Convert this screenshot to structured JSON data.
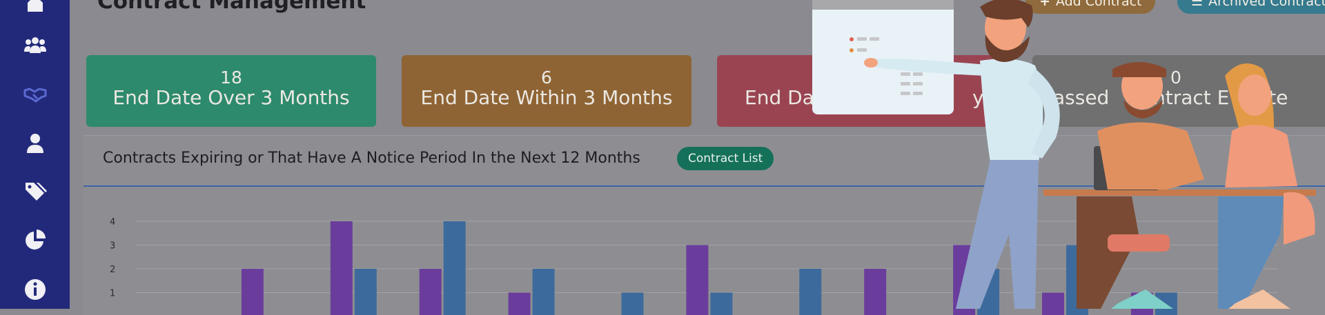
{
  "sidebar": {
    "items": [
      {
        "icon": "home-icon"
      },
      {
        "icon": "users-icon"
      },
      {
        "icon": "handshake-icon",
        "active": true
      },
      {
        "icon": "user-icon"
      },
      {
        "icon": "tags-icon"
      },
      {
        "icon": "pie-chart-icon"
      },
      {
        "icon": "info-icon"
      }
    ],
    "accent": "#5b6ad0"
  },
  "header": {
    "title": "Contract Management",
    "add_label": "Add Contract",
    "archived_label": "Archived Contracts",
    "add_icon": "plus-icon",
    "archived_icon": "list-icon"
  },
  "cards": [
    {
      "value": "18",
      "label": "End Date Over 3 Months",
      "color": "#2d8a6c"
    },
    {
      "value": "6",
      "label": "End Date Within 3 Months",
      "color": "#8f6434"
    },
    {
      "value": "",
      "label": "End Dat",
      "label_tail": "ys",
      "color": "#9a4452"
    },
    {
      "value": "0",
      "label": "assed",
      "label_tail": "ntract E",
      "label_end": "ate",
      "color": "#707070"
    }
  ],
  "panel": {
    "title": "Contracts Expiring or That Have A Notice Period In the Next 12 Months",
    "button_label": "Contract List"
  },
  "chart_data": {
    "type": "bar",
    "ylim": [
      0,
      4
    ],
    "yticks": [
      "1",
      "2",
      "3",
      "4"
    ],
    "grid": true,
    "series": [
      {
        "color": "#6a3d9c",
        "values": [
          0,
          2,
          4,
          2,
          1,
          0,
          3,
          0,
          2,
          3,
          1,
          1
        ]
      },
      {
        "color": "#3d6a9c",
        "values": [
          0,
          0,
          2,
          4,
          2,
          1,
          1,
          2,
          0,
          2,
          3,
          1
        ]
      }
    ]
  }
}
